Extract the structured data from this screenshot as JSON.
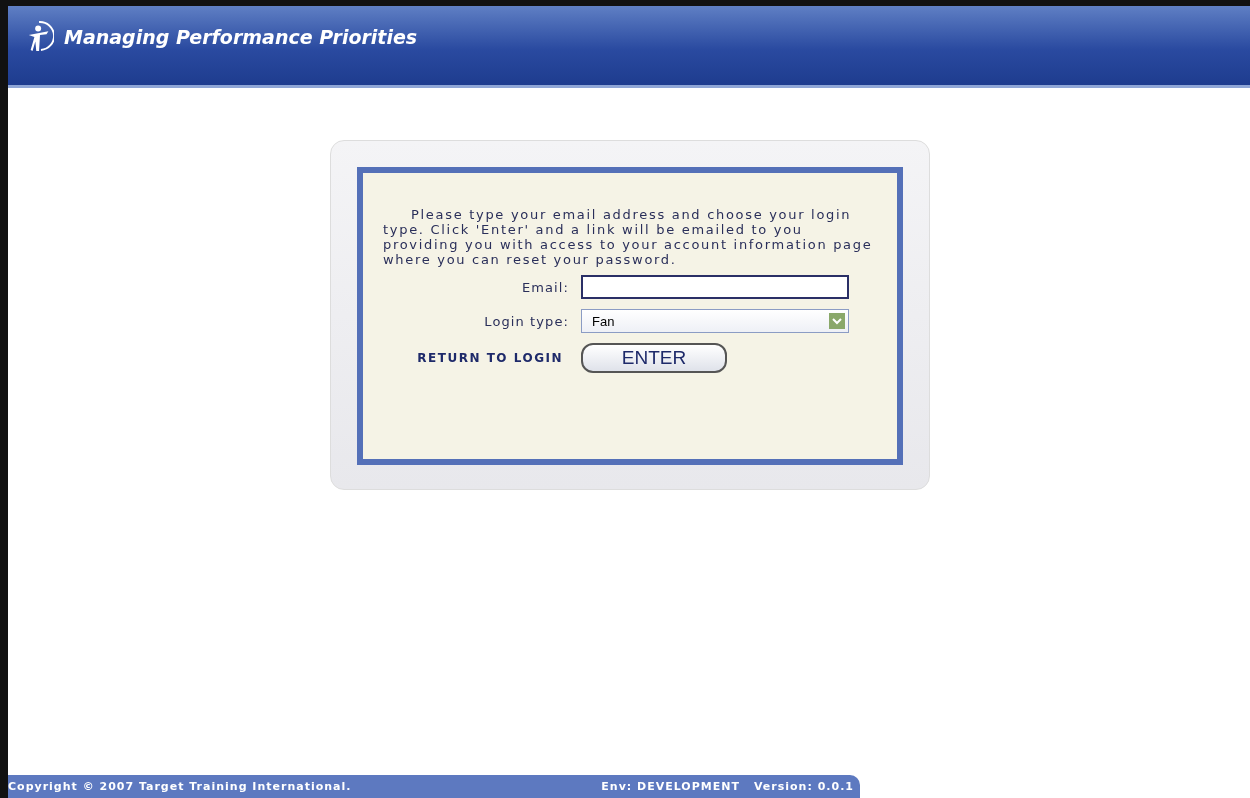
{
  "header": {
    "title": "Managing Performance Priorities"
  },
  "form": {
    "instructions": "Please type your email address and choose your login type. Click 'Enter' and a link will be emailed to you providing you with access to your account information page where you can reset your password.",
    "email": {
      "label": "Email:"
    },
    "login_type": {
      "label": "Login type:",
      "value": "Fan"
    },
    "return_link": "RETURN TO LOGIN",
    "enter_button": "ENTER"
  },
  "footer": {
    "copyright": "Copyright © 2007 Target Training International.",
    "env": "Env: DEVELOPMENT",
    "version": "Version: 0.0.1"
  }
}
